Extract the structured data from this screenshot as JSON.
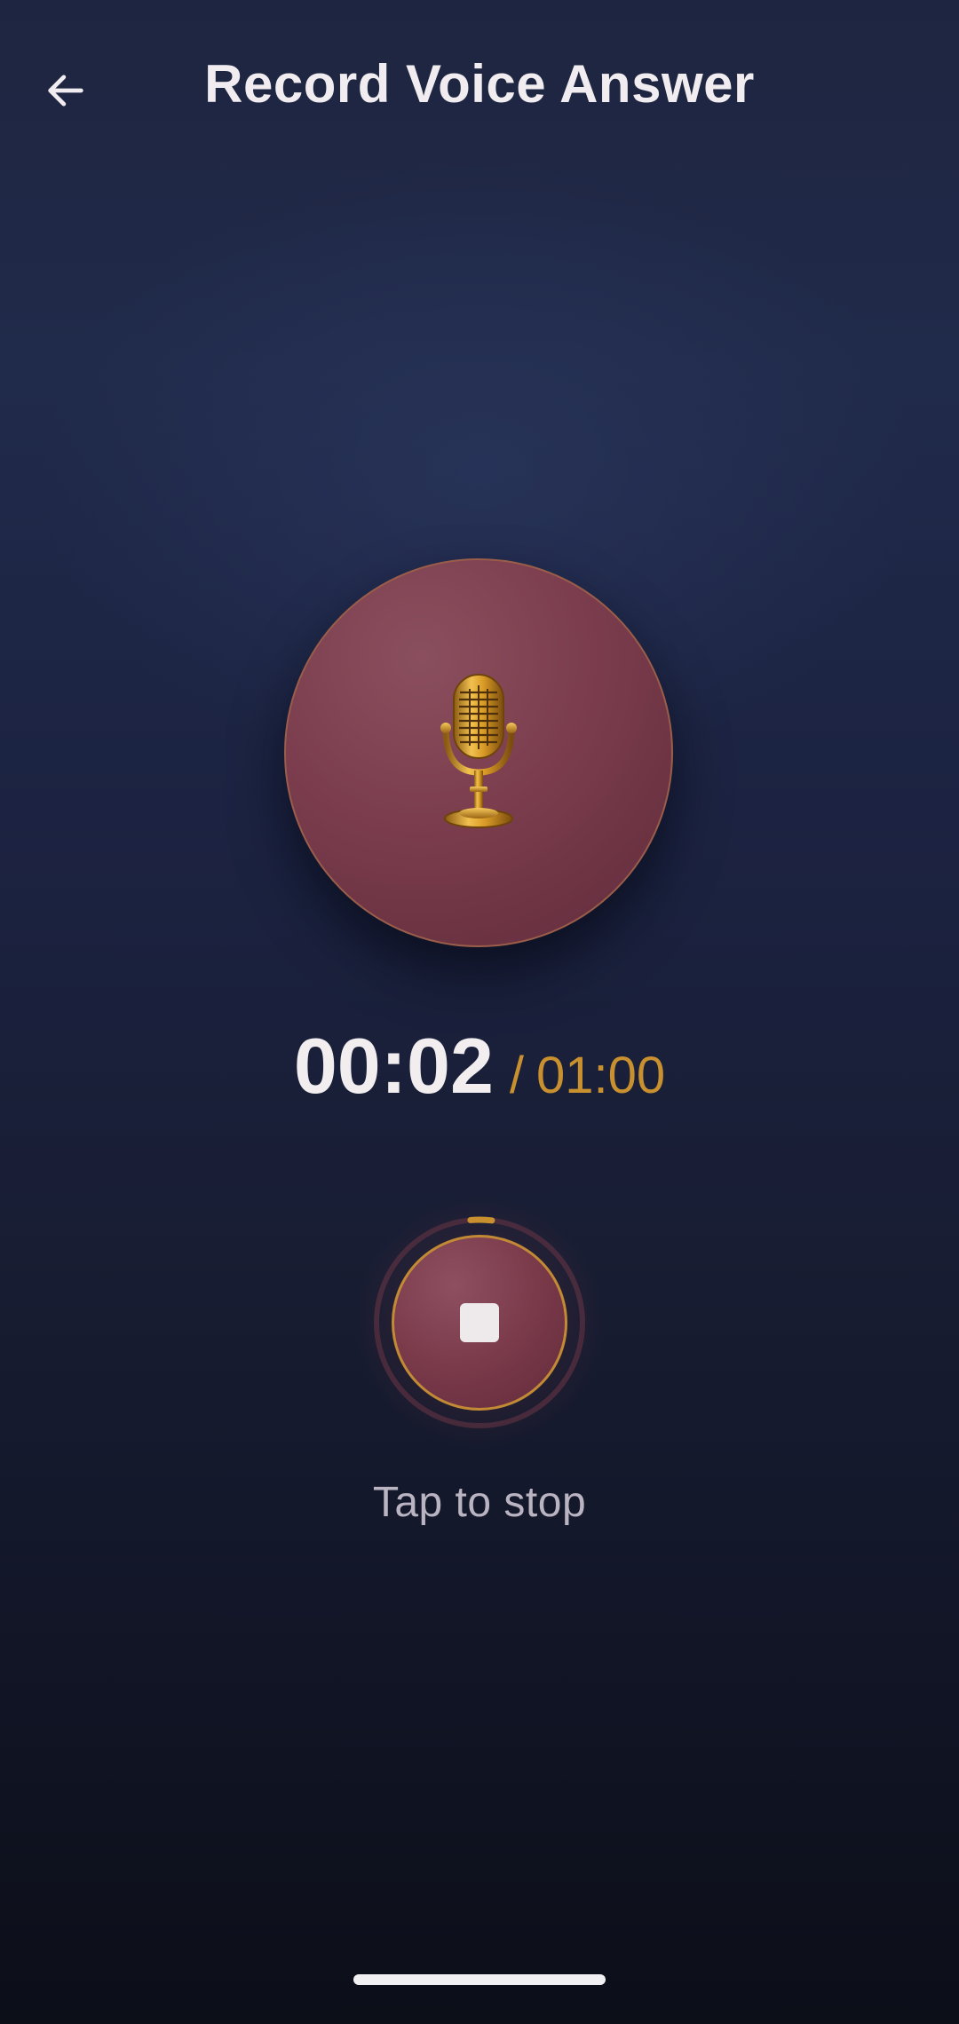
{
  "header": {
    "title": "Record Voice Answer",
    "back_icon": "arrow-left-icon"
  },
  "recorder": {
    "mic_icon": "vintage-microphone-icon",
    "elapsed": "00:02",
    "separator": "/",
    "limit": "01:00",
    "progress_fraction": 0.033,
    "stop_icon": "stop-square-icon",
    "hint": "Tap to stop"
  },
  "colors": {
    "accent_gold": "#c8902e",
    "button_maroon": "#7a3a4a",
    "background_navy": "#1c2342",
    "text_primary": "#f2eeef",
    "text_muted": "#b9b3c2"
  }
}
